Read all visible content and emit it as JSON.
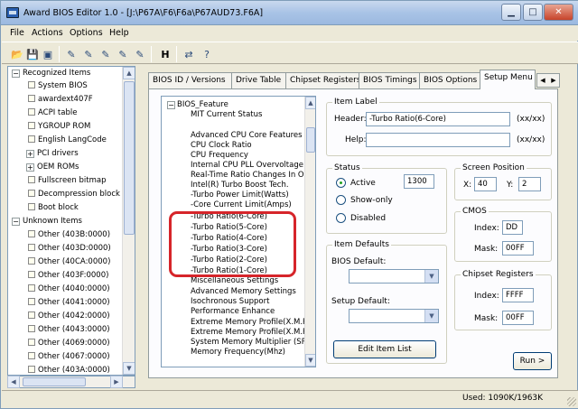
{
  "window": {
    "title": "Award BIOS Editor 1.0 - [J:\\P67A\\F6\\F6a\\P67AUD73.F6A]"
  },
  "menu": [
    "File",
    "Actions",
    "Options",
    "Help"
  ],
  "toolbar_icons": [
    "open-icon",
    "save-icon",
    "save-as-icon",
    "tool1-icon",
    "tool2-icon",
    "tool3-icon",
    "tool4-icon",
    "tool5-icon",
    "h-icon",
    "export-icon",
    "help-icon"
  ],
  "tree": {
    "root1": "Recognized Items",
    "recognized": [
      "System BIOS",
      "awardext407F",
      "ACPI table",
      "YGROUP ROM",
      "English LangCode",
      "PCI drivers",
      "OEM ROMs",
      "Fullscreen bitmap",
      "Decompression block",
      "Boot block"
    ],
    "root2": "Unknown Items",
    "unknown": [
      "Other (403B:0000)",
      "Other (403D:0000)",
      "Other (40CA:0000)",
      "Other (403F:0000)",
      "Other (4040:0000)",
      "Other (4041:0000)",
      "Other (4042:0000)",
      "Other (4043:0000)",
      "Other (4069:0000)",
      "Other (4067:0000)",
      "Other (403A:0000)"
    ]
  },
  "tabs": [
    "BIOS ID / Versions",
    "Drive Table",
    "Chipset Registers",
    "BIOS Timings",
    "BIOS Options",
    "Setup Menu"
  ],
  "active_tab": "Setup Menu",
  "setup_list": {
    "root": "BIOS_Feature",
    "items": [
      "MIT Current Status",
      "",
      "Advanced CPU Core Features",
      "CPU Clock Ratio",
      "CPU Frequency",
      "Internal CPU PLL Overvoltage",
      "Real-Time Ratio Changes In O",
      "Intel(R) Turbo Boost Tech.",
      "-Turbo Power Limit(Watts)",
      "-Core Current Limit(Amps)",
      "-Turbo Ratio(6-Core)",
      "-Turbo Ratio(5-Core)",
      "-Turbo Ratio(4-Core)",
      "-Turbo Ratio(3-Core)",
      "-Turbo Ratio(2-Core)",
      "-Turbo Ratio(1-Core)",
      "Miscellaneous Settings",
      "Advanced Memory Settings",
      "Isochronous Support",
      "Performance Enhance",
      "Extreme Memory Profile(X.M.P",
      "Extreme Memory Profile(X.M.P",
      "System Memory Multiplier (SP",
      "Memory Frequency(Mhz)"
    ]
  },
  "item_label": {
    "group": "Item Label",
    "header_label": "Header:",
    "header_value": "-Turbo Ratio(6-Core)",
    "header_hint": "(xx/xx)",
    "help_label": "Help:",
    "help_value": "",
    "help_hint": "(xx/xx)"
  },
  "status": {
    "group": "Status",
    "active": "Active",
    "active_value": "1300",
    "show_only": "Show-only",
    "disabled": "Disabled"
  },
  "screen_position": {
    "group": "Screen Position",
    "x_label": "X:",
    "x_value": "40",
    "y_label": "Y:",
    "y_value": "2"
  },
  "cmos": {
    "group": "CMOS",
    "index_label": "Index:",
    "index_value": "DD",
    "mask_label": "Mask:",
    "mask_value": "00FF"
  },
  "item_defaults": {
    "group": "Item Defaults",
    "bios_default": "BIOS Default:",
    "setup_default": "Setup Default:",
    "edit_button": "Edit Item List"
  },
  "chipset_registers": {
    "group": "Chipset Registers",
    "index_label": "Index:",
    "index_value": "FFFF",
    "mask_label": "Mask:",
    "mask_value": "00FF"
  },
  "run_button": "Run >",
  "statusbar": {
    "used": "Used: 1090K/1963K"
  },
  "colors": {
    "highlight": "#d6252a",
    "title_bar": "#a9c3e6"
  }
}
